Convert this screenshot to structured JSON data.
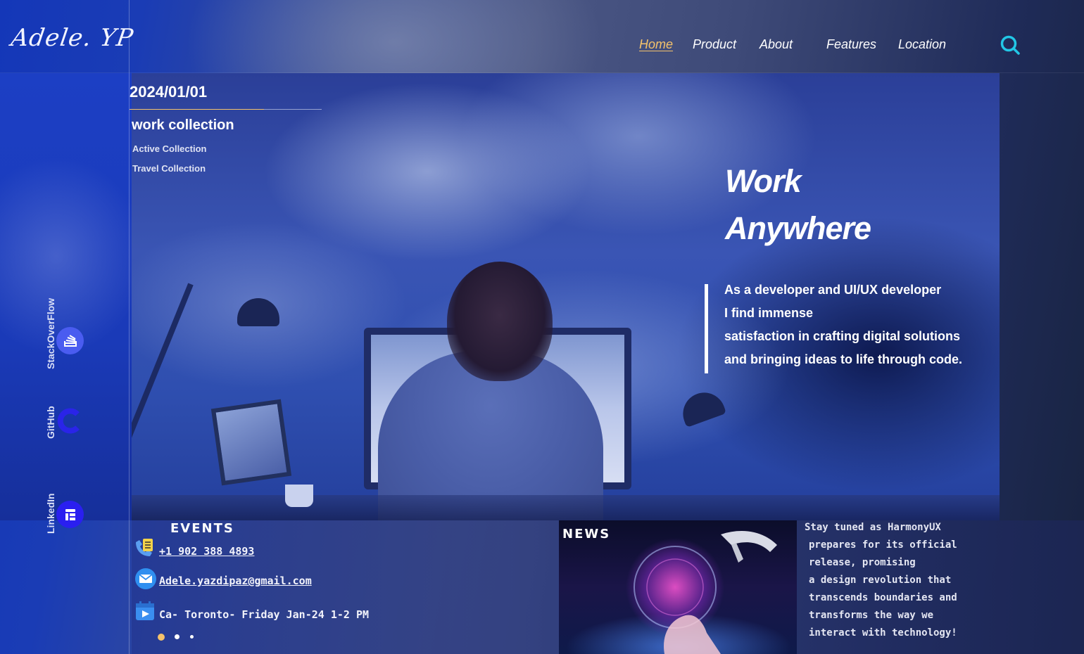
{
  "header": {
    "logo": "Adele. YP",
    "nav": [
      {
        "label": "Home",
        "active": true
      },
      {
        "label": "Product",
        "active": false
      },
      {
        "label": "About",
        "active": false
      },
      {
        "label": "Features",
        "active": false
      },
      {
        "label": "Location",
        "active": false
      }
    ],
    "search_icon": "search-icon"
  },
  "collection": {
    "date": "2024/01/01",
    "title": "work collection",
    "links": [
      "Active Collection",
      "Travel Collection"
    ]
  },
  "hero": {
    "title_lines": [
      "Work",
      "Anywhere"
    ],
    "description_lines": [
      "As a developer and UI/UX developer",
      "I find immense",
      "satisfaction in crafting digital solutions",
      "and bringing ideas to life through code."
    ]
  },
  "social": [
    {
      "label": "StackOverFlow",
      "icon": "stackoverflow-icon"
    },
    {
      "label": "GitHub",
      "icon": "github-icon"
    },
    {
      "label": "LinkedIn",
      "icon": "linkedin-icon"
    }
  ],
  "events": {
    "title": "EVENTS",
    "phone": "+1 902 388 4893",
    "email": "Adele.yazdipaz@gmail.com",
    "event": "Ca- Toronto- Friday Jan-24 1-2 PM",
    "pager_active_index": 0,
    "pager_count": 3
  },
  "news": {
    "title": "NEWS",
    "lines": [
      "Stay tuned as HarmonyUX",
      "prepares for its official",
      "release, promising",
      "a design revolution that",
      "transcends boundaries and",
      "transforms the way we",
      "interact with technology!"
    ]
  },
  "colors": {
    "accent": "#f4c26b",
    "search": "#22c7e6",
    "social_icon_bg": "#3a3ff0"
  }
}
